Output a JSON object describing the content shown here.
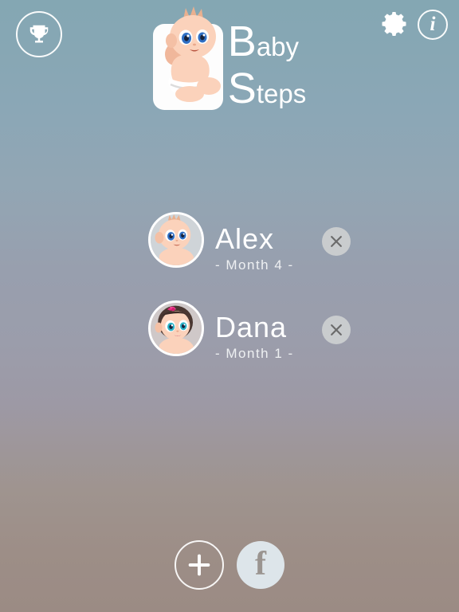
{
  "app": {
    "name_line1_cap": "B",
    "name_line1_rest": "aby",
    "name_line2_cap": "S",
    "name_line2_rest": "teps",
    "logo_icon": "baby-logo-icon"
  },
  "topbar": {
    "trophy_icon": "trophy-icon",
    "gear_icon": "gear-icon",
    "info_icon": "info-icon",
    "info_glyph": "i"
  },
  "babies": [
    {
      "name": "Alex",
      "month_label": "- Month 4 -",
      "avatar_icon": "baby-boy-avatar-icon",
      "delete_icon": "close-x-icon"
    },
    {
      "name": "Dana",
      "month_label": "- Month 1 -",
      "avatar_icon": "baby-girl-avatar-icon",
      "delete_icon": "close-x-icon"
    }
  ],
  "bottom": {
    "add_icon": "plus-icon",
    "facebook_icon": "facebook-icon",
    "facebook_glyph": "f"
  },
  "colors": {
    "background_top": "#84a7b3",
    "background_bottom": "#9b8b84",
    "text_white": "#ffffff",
    "delete_circle": "#c9ccce",
    "facebook_circle": "#dde5ea",
    "facebook_glyph": "#9a9490"
  }
}
